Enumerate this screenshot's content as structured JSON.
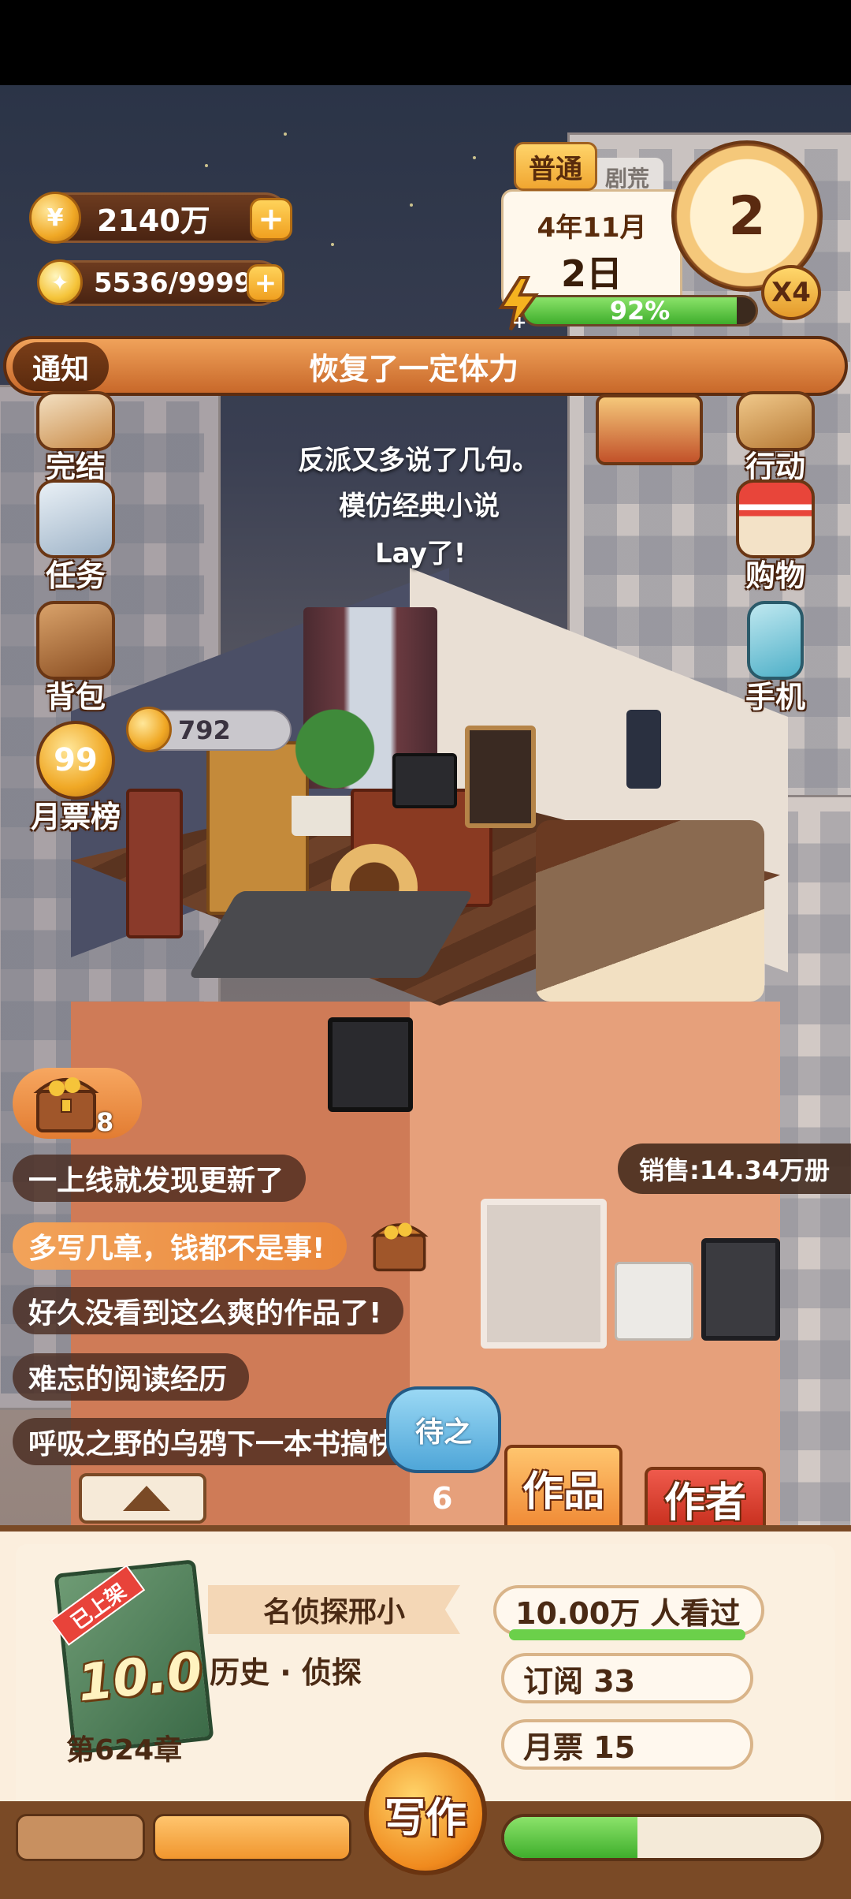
{
  "resources": {
    "gold": "2140万",
    "inspiration": "5536/9999"
  },
  "calendar": {
    "mode": "普通",
    "tab_behind": "剧荒",
    "year_month": "4年11月",
    "day": "2日",
    "clock_value": "2",
    "speed": "X4",
    "energy_percent": "92%",
    "energy_fraction": 0.92
  },
  "notice": {
    "label": "通知",
    "text": "恢复了一定体力"
  },
  "left_menu": [
    {
      "label": "完结",
      "icon": "book-finish-icon"
    },
    {
      "label": "任务",
      "icon": "checklist-icon"
    },
    {
      "label": "背包",
      "icon": "backpack-icon"
    },
    {
      "label": "月票榜",
      "icon": "ranking-99-icon"
    }
  ],
  "right_menu": [
    {
      "label": "行动",
      "icon": "door-action-icon"
    },
    {
      "label": "购物",
      "icon": "shop-icon"
    },
    {
      "label": "手机",
      "icon": "phone-icon"
    }
  ],
  "float_texts": [
    "反派又多说了几句。",
    "模仿经典小说",
    "Lay了!"
  ],
  "room": {
    "price": "792"
  },
  "chest": {
    "count": "8"
  },
  "sales": "销售:14.34万册",
  "comments": [
    {
      "text": "一上线就发现更新了",
      "highlight": false
    },
    {
      "text": "多写几章，钱都不是事!",
      "highlight": true
    },
    {
      "text": "好久没看到这么爽的作品了!",
      "highlight": false
    },
    {
      "text": "难忘的阅读经历",
      "highlight": false
    },
    {
      "text": "呼吸之野的乌鸦下一本书搞快点!",
      "highlight": false
    }
  ],
  "waiting": {
    "label": "待之",
    "count": "6"
  },
  "tabs": {
    "works": "作品",
    "author": "作者"
  },
  "book": {
    "status": "已上架",
    "score": "10.0",
    "title": "名侦探邢小",
    "genre": "历史 · 侦探",
    "chapter": "第624章",
    "readers": "10.00万 人看过",
    "subscriptions": "订阅 33",
    "monthly_tickets": "月票 15"
  },
  "write_button": "写作",
  "progress_fraction": 0.42,
  "colors": {
    "accent": "#f08a36",
    "panel": "#fbeedd",
    "energy": "#3fae2c",
    "author_tab": "#c8301f"
  }
}
